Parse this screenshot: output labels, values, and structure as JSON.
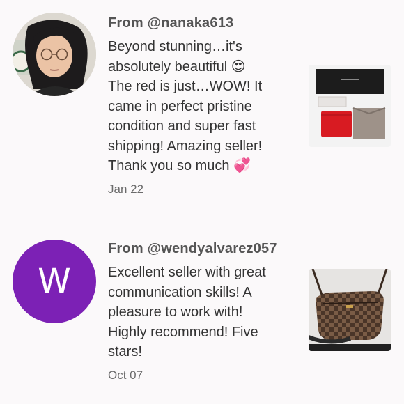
{
  "reviews": [
    {
      "from": "From @nanaka613",
      "text": "Beyond stunning…it's\nabsolutely beautiful 😍\nThe red is just…WOW! It\ncame in perfect pristine\ncondition and super fast\nshipping! Amazing seller!\nThank you so much 💞",
      "date": "Jan 22",
      "avatar_type": "photo",
      "thumbnail": "wallet-with-box-and-dustbag"
    },
    {
      "from": "From @wendyalvarez057",
      "text": "Excellent seller with great\ncommunication skills! A\npleasure to work with!\nHighly recommend! Five\nstars!",
      "date": "Oct 07",
      "avatar_type": "letter",
      "avatar_letter": "W",
      "avatar_color": "#7c21b5",
      "thumbnail": "checkered-crossbody-bag"
    }
  ],
  "colors": {
    "background": "#fbf9fa",
    "divider": "#e3e1e2",
    "username": "#555555",
    "body_text": "#333333",
    "date": "#6b6b6b"
  }
}
